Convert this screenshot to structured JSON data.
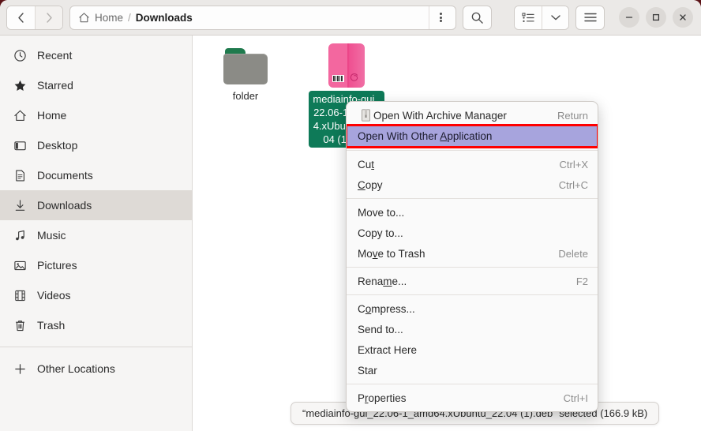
{
  "window": {
    "title": "Downloads"
  },
  "header": {
    "back_label": "Back",
    "forward_label": "Forward",
    "breadcrumbs": [
      {
        "label": "Home",
        "icon": "home-icon",
        "current": false
      },
      {
        "label": "Downloads",
        "icon": null,
        "current": true
      }
    ],
    "separator": "/",
    "path_menu_label": "Path options",
    "search_label": "Search",
    "view_list_label": "List view",
    "view_dropdown_label": "View options",
    "main_menu_label": "Main menu",
    "minimize_label": "–",
    "maximize_label": "□",
    "close_label": "×"
  },
  "sidebar": {
    "items": [
      {
        "label": "Recent",
        "icon": "clock-icon",
        "selected": false
      },
      {
        "label": "Starred",
        "icon": "star-icon",
        "selected": false
      },
      {
        "label": "Home",
        "icon": "home-icon",
        "selected": false
      },
      {
        "label": "Desktop",
        "icon": "desktop-icon",
        "selected": false
      },
      {
        "label": "Documents",
        "icon": "document-icon",
        "selected": false
      },
      {
        "label": "Downloads",
        "icon": "download-icon",
        "selected": true
      },
      {
        "label": "Music",
        "icon": "music-icon",
        "selected": false
      },
      {
        "label": "Pictures",
        "icon": "picture-icon",
        "selected": false
      },
      {
        "label": "Videos",
        "icon": "video-icon",
        "selected": false
      },
      {
        "label": "Trash",
        "icon": "trash-icon",
        "selected": false
      }
    ],
    "other_locations": {
      "label": "Other Locations",
      "icon": "plus-icon"
    }
  },
  "files": [
    {
      "name": "folder",
      "icon": "folder-icon",
      "selected": false
    },
    {
      "name": "mediainfo-gui_22.06-1_amd64.xUbuntu_22.04 (1).deb",
      "icon": "deb-package-icon",
      "selected": true
    }
  ],
  "context_menu": {
    "items": [
      {
        "label": "Open With Archive Manager",
        "accel": "Return",
        "icon": "archive-file-icon",
        "highlight": false,
        "mnemonic": null
      },
      {
        "label": "Open With Other Application",
        "accel": "",
        "icon": null,
        "highlight": true,
        "mnemonic": "A"
      },
      {
        "separator": true
      },
      {
        "label": "Cut",
        "accel": "Ctrl+X",
        "icon": null,
        "highlight": false,
        "mnemonic": "t"
      },
      {
        "label": "Copy",
        "accel": "Ctrl+C",
        "icon": null,
        "highlight": false,
        "mnemonic": "C"
      },
      {
        "separator": true
      },
      {
        "label": "Move to...",
        "accel": "",
        "icon": null,
        "highlight": false,
        "mnemonic": null
      },
      {
        "label": "Copy to...",
        "accel": "",
        "icon": null,
        "highlight": false,
        "mnemonic": null
      },
      {
        "label": "Move to Trash",
        "accel": "Delete",
        "icon": null,
        "highlight": false,
        "mnemonic": "v"
      },
      {
        "separator": true
      },
      {
        "label": "Rename...",
        "accel": "F2",
        "icon": null,
        "highlight": false,
        "mnemonic": "m"
      },
      {
        "separator": true
      },
      {
        "label": "Compress...",
        "accel": "",
        "icon": null,
        "highlight": false,
        "mnemonic": "o"
      },
      {
        "label": "Send to...",
        "accel": "",
        "icon": null,
        "highlight": false,
        "mnemonic": null
      },
      {
        "label": "Extract Here",
        "accel": "",
        "icon": null,
        "highlight": false,
        "mnemonic": null
      },
      {
        "label": "Star",
        "accel": "",
        "icon": null,
        "highlight": false,
        "mnemonic": null
      },
      {
        "label": "Properties",
        "accel": "Ctrl+I",
        "icon": null,
        "highlight": false,
        "mnemonic": "r"
      }
    ]
  },
  "statusbar": {
    "text": "“mediainfo-gui_22.06-1_amd64.xUbuntu_22.04 (1).deb” selected  (166.9 kB)"
  },
  "colors": {
    "headerbar": "#ebe9e7",
    "sidebar": "#f6f5f4",
    "selection_green": "#0e7a58",
    "menu_highlight": "#a7a4dd",
    "highlight_outline": "#ff0000",
    "deb_pink": "#f3679f",
    "folder_green": "#1f7a4d"
  }
}
